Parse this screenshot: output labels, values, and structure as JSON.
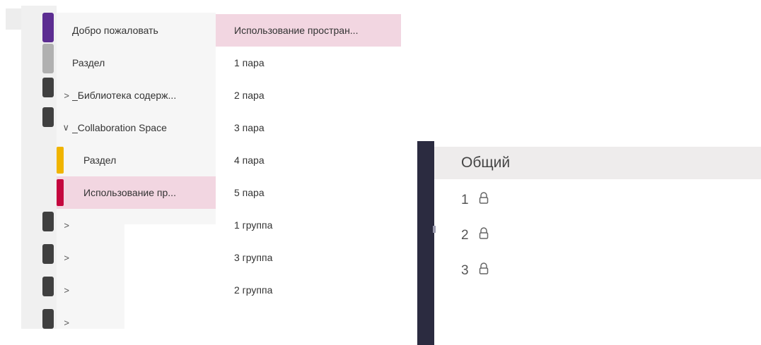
{
  "sections": [
    {
      "label": "Добро пожаловать",
      "chevron": "",
      "marker_color": "",
      "selected": false
    },
    {
      "label": "Раздел",
      "chevron": "",
      "marker_color": "",
      "selected": false
    },
    {
      "label": "_Библиотека содерж...",
      "chevron": ">",
      "marker_color": "",
      "selected": false
    },
    {
      "label": "_Collaboration Space",
      "chevron": "∨",
      "marker_color": "",
      "selected": false
    },
    {
      "label": "Раздел",
      "chevron": "",
      "marker_color": "#f0b400",
      "selected": false
    },
    {
      "label": "Использование пр...",
      "chevron": "",
      "marker_color": "#c4063e",
      "selected": true
    },
    {
      "label": "",
      "chevron": ">",
      "marker_color": "",
      "selected": false
    },
    {
      "label": "",
      "chevron": ">",
      "marker_color": "",
      "selected": false
    },
    {
      "label": "",
      "chevron": ">",
      "marker_color": "",
      "selected": false
    },
    {
      "label": "",
      "chevron": ">",
      "marker_color": "",
      "selected": false
    }
  ],
  "pages": [
    {
      "label": "Использование простран...",
      "selected": true
    },
    {
      "label": "1 пара",
      "selected": false
    },
    {
      "label": "2 пара",
      "selected": false
    },
    {
      "label": "3 пара",
      "selected": false
    },
    {
      "label": "4 пара",
      "selected": false
    },
    {
      "label": "5 пара",
      "selected": false
    },
    {
      "label": "1 группа",
      "selected": false
    },
    {
      "label": "3 группа",
      "selected": false
    },
    {
      "label": "2 группа",
      "selected": false
    }
  ],
  "notebook_colors": [
    "#5c2d91",
    "#b0b0b0",
    "#404040",
    "#404040",
    "#404040",
    "#404040",
    "#404040",
    "#404040"
  ],
  "teams": {
    "header": "Общий",
    "channels": [
      {
        "label": "1",
        "icon": "lock-icon"
      },
      {
        "label": "2",
        "icon": "lock-icon"
      },
      {
        "label": "3",
        "icon": "lock-icon"
      }
    ]
  }
}
